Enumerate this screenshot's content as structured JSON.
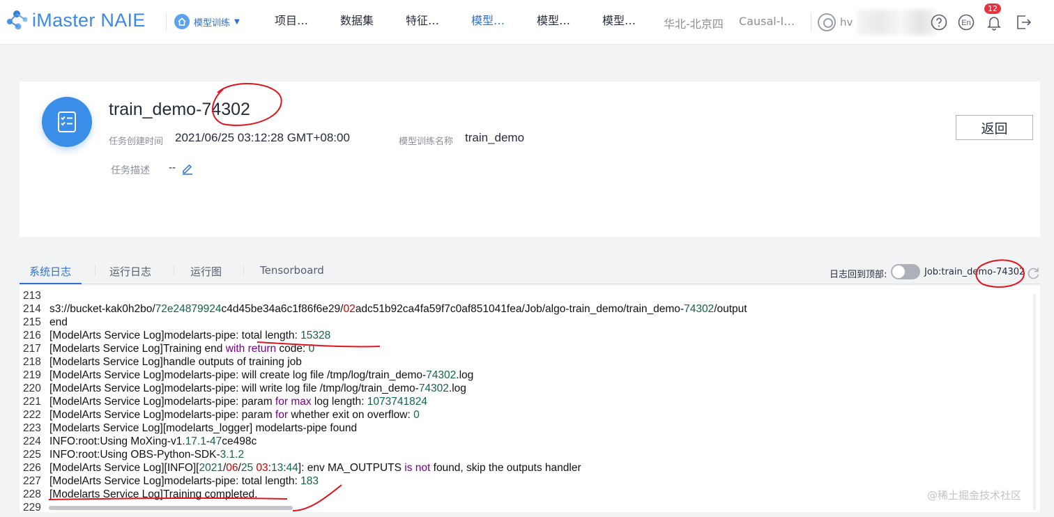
{
  "brand": "iMaster NAIE",
  "module": {
    "label": "模型训练"
  },
  "nav": [
    "项目…",
    "数据集",
    "特征…",
    "模型…",
    "模型…",
    "模型…"
  ],
  "region": "华北-北京四",
  "project": "Causal-I…",
  "user": {
    "name": "hv"
  },
  "notifications": {
    "count": "12"
  },
  "job": {
    "title": "train_demo-74302",
    "created_label": "任务创建时间",
    "created_value": "2021/06/25 03:12:28 GMT+08:00",
    "model_label": "模型训练名称",
    "model_value": "train_demo",
    "desc_label": "任务描述",
    "desc_value": "--"
  },
  "back_button": "返回",
  "tabs": [
    "系统日志",
    "运行日志",
    "运行图",
    "Tensorboard"
  ],
  "log_toolbar": {
    "top_label": "日志回到顶部:",
    "job_label": "Job:train_demo-74302"
  },
  "log_lines": [
    {
      "n": "213",
      "segs": []
    },
    {
      "n": "214",
      "segs": [
        [
          "s3://bucket-kak0h2bo/",
          ""
        ],
        [
          "72e24879924",
          "num"
        ],
        [
          "c4d45be34a6c1f86f6e29/",
          ""
        ],
        [
          "02",
          "red"
        ],
        [
          "adc51b92ca4fa59f7c0af851041fea/Job/algo-train_demo/train_demo-",
          ""
        ],
        [
          "74302",
          "num"
        ],
        [
          "/output",
          ""
        ]
      ]
    },
    {
      "n": "215",
      "segs": [
        [
          "end",
          ""
        ]
      ]
    },
    {
      "n": "216",
      "segs": [
        [
          "[ModelArts Service Log]modelarts-pipe: total length: ",
          ""
        ],
        [
          "15328",
          "num"
        ]
      ]
    },
    {
      "n": "217",
      "segs": [
        [
          "[Modelarts Service Log]Training end ",
          ""
        ],
        [
          "with",
          "kw"
        ],
        [
          " ",
          ""
        ],
        [
          "return",
          "kw"
        ],
        [
          " code: ",
          ""
        ],
        [
          "0",
          "num"
        ]
      ]
    },
    {
      "n": "218",
      "segs": [
        [
          "[Modelarts Service Log]handle outputs of training job",
          ""
        ]
      ]
    },
    {
      "n": "219",
      "segs": [
        [
          "[ModelArts Service Log]modelarts-pipe: will create log file /tmp/log/train_demo-",
          ""
        ],
        [
          "74302",
          "num"
        ],
        [
          ".log",
          ""
        ]
      ]
    },
    {
      "n": "220",
      "segs": [
        [
          "[ModelArts Service Log]modelarts-pipe: will write log file /tmp/log/train_demo-",
          ""
        ],
        [
          "74302",
          "num"
        ],
        [
          ".log",
          ""
        ]
      ]
    },
    {
      "n": "221",
      "segs": [
        [
          "[ModelArts Service Log]modelarts-pipe: param ",
          ""
        ],
        [
          "for",
          "kw"
        ],
        [
          " ",
          ""
        ],
        [
          "max",
          "kw"
        ],
        [
          " log length: ",
          ""
        ],
        [
          "1073741824",
          "num"
        ]
      ]
    },
    {
      "n": "222",
      "segs": [
        [
          "[ModelArts Service Log]modelarts-pipe: param ",
          ""
        ],
        [
          "for",
          "kw"
        ],
        [
          " whether exit on overflow: ",
          ""
        ],
        [
          "0",
          "num"
        ]
      ]
    },
    {
      "n": "223",
      "segs": [
        [
          "[Modelarts Service Log][modelarts_logger] modelarts-pipe found",
          ""
        ]
      ]
    },
    {
      "n": "224",
      "segs": [
        [
          "INFO:root:Using MoXing-v1.",
          ""
        ],
        [
          "17.1",
          "num"
        ],
        [
          "-",
          ""
        ],
        [
          "47",
          "num"
        ],
        [
          "ce498c",
          ""
        ]
      ]
    },
    {
      "n": "225",
      "segs": [
        [
          "INFO:root:Using OBS-Python-SDK-",
          ""
        ],
        [
          "3.1.2",
          "num"
        ]
      ]
    },
    {
      "n": "226",
      "segs": [
        [
          "[ModelArts Service Log][INFO][",
          ""
        ],
        [
          "2021",
          "num"
        ],
        [
          "/",
          ""
        ],
        [
          "06",
          "red"
        ],
        [
          "/",
          ""
        ],
        [
          "25",
          "num"
        ],
        [
          " ",
          ""
        ],
        [
          "03",
          "red"
        ],
        [
          ":",
          ""
        ],
        [
          "13",
          "num"
        ],
        [
          ":",
          ""
        ],
        [
          "44",
          "num"
        ],
        [
          "]: env MA_OUTPUTS ",
          ""
        ],
        [
          "is",
          "kw"
        ],
        [
          " ",
          ""
        ],
        [
          "not",
          "kw"
        ],
        [
          " found, skip the outputs handler",
          ""
        ]
      ]
    },
    {
      "n": "227",
      "segs": [
        [
          "[ModelArts Service Log]modelarts-pipe: total length: ",
          ""
        ],
        [
          "183",
          "num"
        ]
      ]
    },
    {
      "n": "228",
      "segs": [
        [
          "[Modelarts Service Log]Training completed.",
          ""
        ]
      ]
    },
    {
      "n": "229",
      "segs": []
    }
  ],
  "watermark": "@稀土掘金技术社区",
  "colors": {
    "accent": "#2e6fd6",
    "brand": "#3b88e8",
    "annotation": "#e0141e",
    "number": "#116644",
    "keyword": "#770088"
  }
}
